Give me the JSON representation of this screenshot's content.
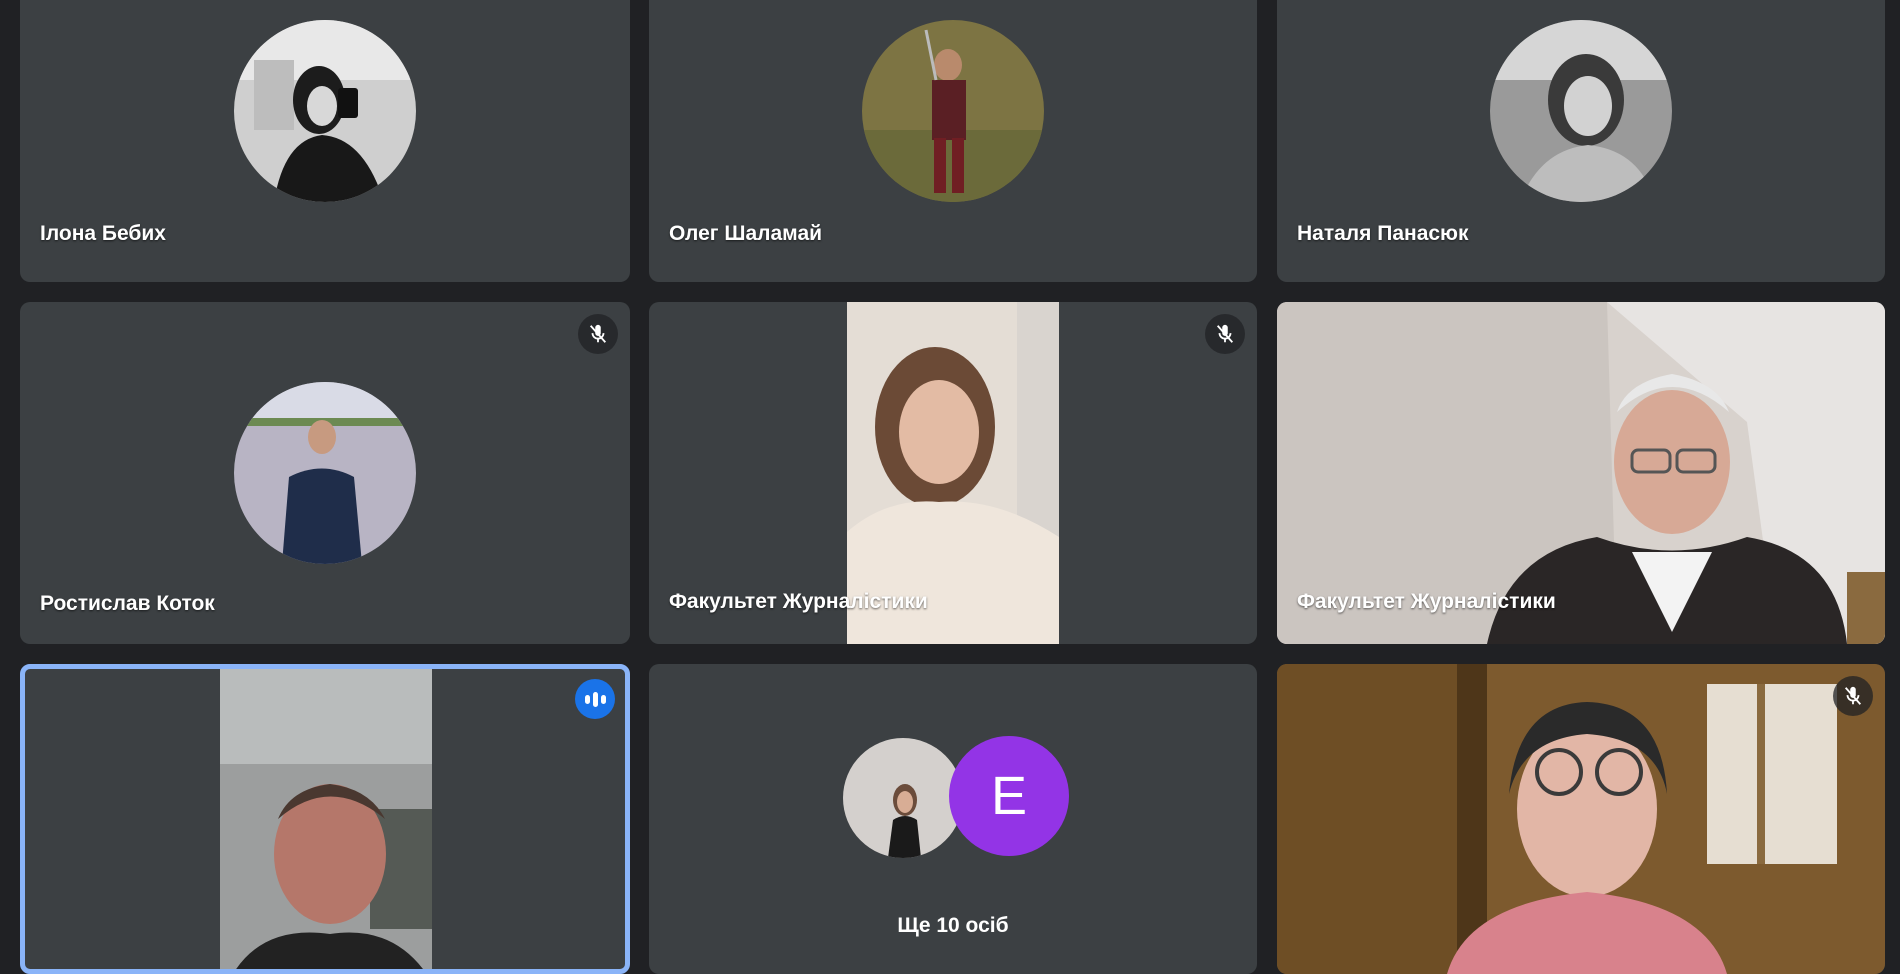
{
  "participants": [
    {
      "name": "Ілона Бебих"
    },
    {
      "name": "Олег Шаламай"
    },
    {
      "name": "Наталя Панасюк"
    },
    {
      "name": "Ростислав Коток"
    },
    {
      "name": "Факультет Журналістики"
    },
    {
      "name": "Факультет Журналістики"
    },
    {
      "name": ""
    },
    {
      "name": ""
    },
    {
      "name": ""
    }
  ],
  "overflow": {
    "label": "Ще 10 осіб",
    "letter_avatar": "E"
  },
  "colors": {
    "background": "#202124",
    "tile": "#3c4043",
    "active_border": "#8ab4f8",
    "speaking_badge": "#1a73e8",
    "letter_avatar": "#9334e6"
  },
  "icons": [
    "mic-off-icon",
    "speaking-indicator-icon"
  ]
}
